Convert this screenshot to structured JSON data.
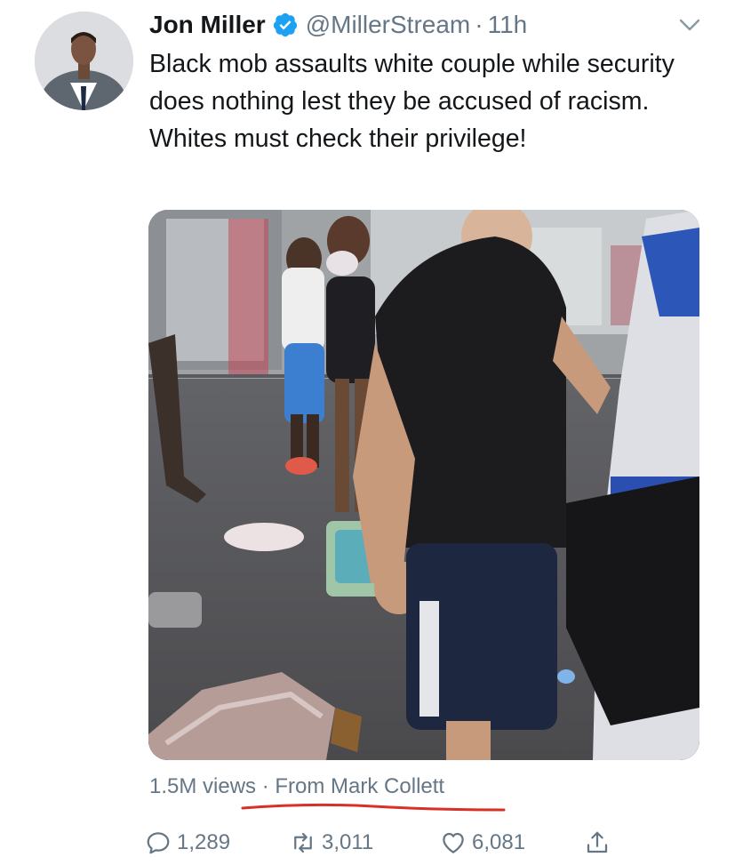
{
  "tweet": {
    "author": {
      "display_name": "Jon Miller",
      "handle": "@MillerStream",
      "verified": true,
      "avatar_icon": "profile-photo"
    },
    "separator": "·",
    "timestamp": "11h",
    "text": "Black mob assaults white couple while security does nothing lest they be accused of racism. Whites must check their privilege!",
    "media": {
      "type": "video-still"
    },
    "views": "1.5M views",
    "meta_separator": "·",
    "attribution": "From Mark Collett",
    "actions": {
      "reply_count": "1,289",
      "retweet_count": "3,011",
      "like_count": "6,081"
    }
  },
  "colors": {
    "text": "#14171a",
    "secondary": "#657786",
    "verified_badge": "#1da1f2",
    "annotation_underline": "#d93025"
  }
}
